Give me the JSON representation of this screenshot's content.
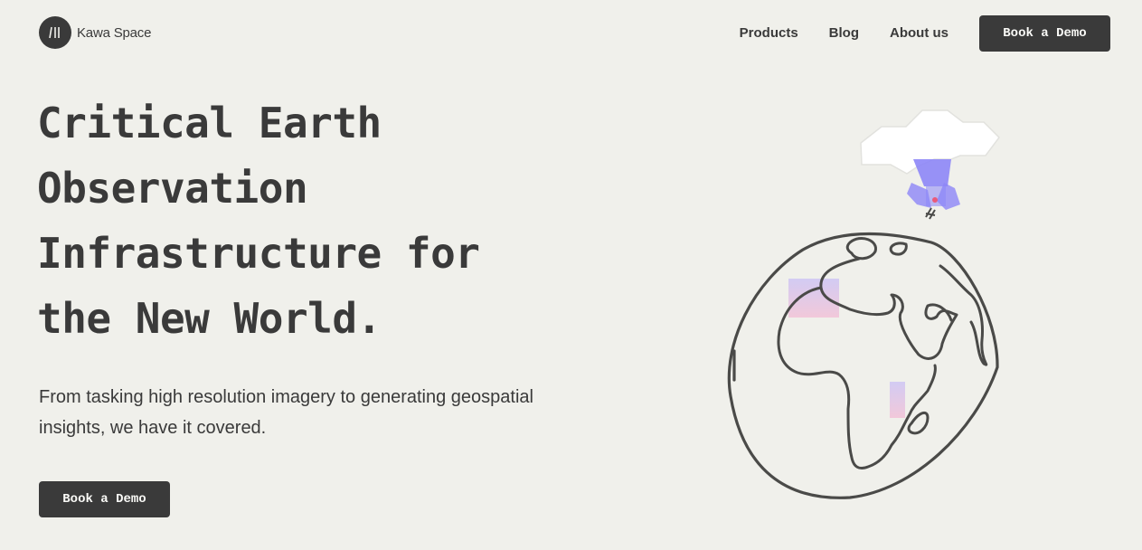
{
  "brand": {
    "name": "Kawa Space",
    "logo_icon": "three-bars-logo-icon"
  },
  "nav": {
    "items": [
      {
        "label": "Products"
      },
      {
        "label": "Blog"
      },
      {
        "label": "About us"
      }
    ],
    "cta_label": "Book a Demo"
  },
  "hero": {
    "title_lines": [
      "Critical Earth",
      "Observation",
      "Infrastructure for",
      "the New World."
    ],
    "subtitle": "From tasking high resolution imagery to generating geospatial insights, we have it covered.",
    "cta_label": "Book a Demo"
  },
  "illustration": {
    "icon": "globe-satellite-illustration",
    "colors": {
      "line": "#4a4a48",
      "satellite": "#8d86f7",
      "cloud": "#ffffff",
      "highlight_pink": "#f2c4d8",
      "highlight_lavender": "#cfc7f4"
    }
  },
  "colors": {
    "background": "#f0f0eb",
    "text": "#3a3a3a",
    "button_bg": "#3a3a3a",
    "button_text": "#fafaf7"
  }
}
